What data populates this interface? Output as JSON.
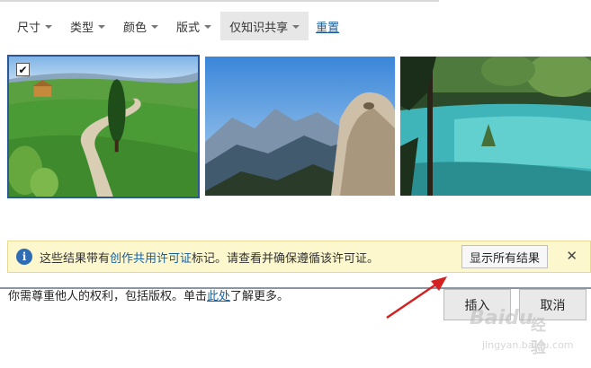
{
  "filters": [
    {
      "label": "尺寸"
    },
    {
      "label": "类型"
    },
    {
      "label": "颜色"
    },
    {
      "label": "版式"
    },
    {
      "label": "仅知识共享",
      "active": true
    }
  ],
  "reset_label": "重置",
  "images": [
    {
      "selected": true,
      "check_mark": "✔"
    },
    {
      "selected": false
    },
    {
      "selected": false
    }
  ],
  "notice": {
    "icon": "info-icon",
    "icon_glyph": "i",
    "text_before": "这些结果带有",
    "link_text": "创作共用许可证",
    "text_after": "标记。请查看并确保遵循该许可证。",
    "show_all_label": "显示所有结果",
    "close_glyph": "✕"
  },
  "rights": {
    "before": "你需尊重他人的权利，包括版权。单击",
    "link": "此处",
    "after": "了解更多。"
  },
  "buttons": {
    "insert": "插入",
    "cancel": "取消"
  },
  "watermark": {
    "brand": "Baidu",
    "brand_cn": "经验",
    "url": "jingyan.baidu.com"
  },
  "colors": {
    "accent": "#2b5797",
    "link": "#1a5f9e",
    "notice_bg": "#fdf7cd",
    "annotation_arrow": "#d42020"
  }
}
